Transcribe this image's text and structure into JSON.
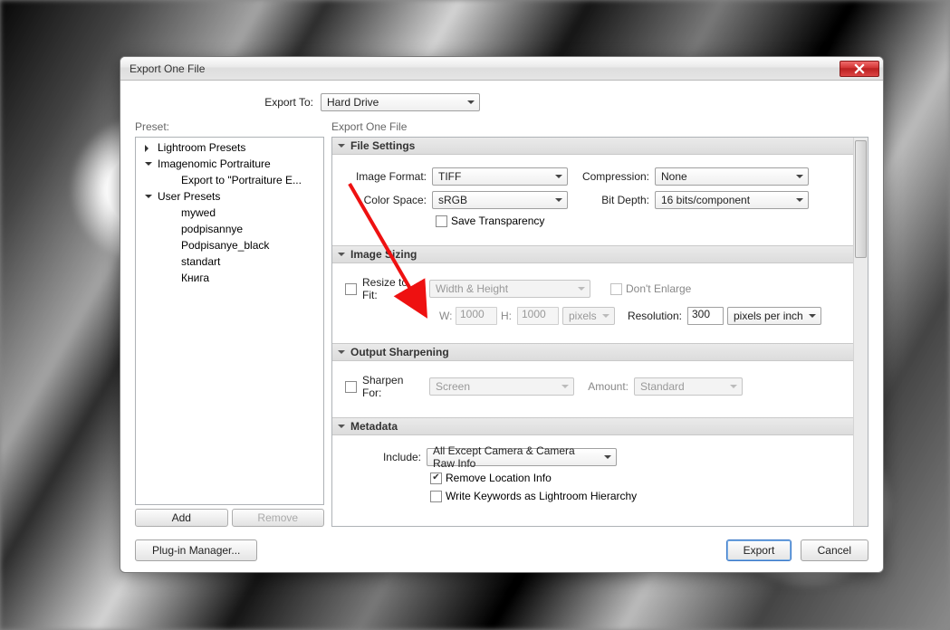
{
  "window": {
    "title": "Export One File"
  },
  "exportTo": {
    "label": "Export To:",
    "value": "Hard Drive"
  },
  "preset": {
    "label": "Preset:",
    "groups": [
      {
        "label": "Lightroom Presets",
        "expanded": false,
        "items": []
      },
      {
        "label": "Imagenomic Portraiture",
        "expanded": true,
        "items": [
          {
            "label": "Export to \"Portraiture E..."
          }
        ]
      },
      {
        "label": "User Presets",
        "expanded": true,
        "items": [
          {
            "label": "mywed"
          },
          {
            "label": "podpisannye"
          },
          {
            "label": "Podpisanye_black"
          },
          {
            "label": "standart"
          },
          {
            "label": "Книга"
          }
        ]
      }
    ],
    "addButton": "Add",
    "removeButton": "Remove"
  },
  "settings": {
    "heading": "Export One File",
    "fileSettings": {
      "title": "File Settings",
      "imageFormat": {
        "label": "Image Format:",
        "value": "TIFF"
      },
      "compression": {
        "label": "Compression:",
        "value": "None"
      },
      "colorSpace": {
        "label": "Color Space:",
        "value": "sRGB"
      },
      "bitDepth": {
        "label": "Bit Depth:",
        "value": "16 bits/component"
      },
      "saveTransparency": {
        "label": "Save Transparency",
        "checked": false
      }
    },
    "imageSizing": {
      "title": "Image Sizing",
      "resizeToFit": {
        "label": "Resize to Fit:",
        "checked": false,
        "mode": "Width & Height"
      },
      "dontEnlarge": {
        "label": "Don't Enlarge",
        "checked": false
      },
      "w": {
        "label": "W:",
        "value": "1000"
      },
      "h": {
        "label": "H:",
        "value": "1000"
      },
      "unit": "pixels",
      "resolution": {
        "label": "Resolution:",
        "value": "300",
        "unit": "pixels per inch"
      }
    },
    "outputSharpening": {
      "title": "Output Sharpening",
      "sharpenFor": {
        "label": "Sharpen For:",
        "checked": false,
        "value": "Screen"
      },
      "amount": {
        "label": "Amount:",
        "value": "Standard"
      }
    },
    "metadata": {
      "title": "Metadata",
      "include": {
        "label": "Include:",
        "value": "All Except Camera & Camera Raw Info"
      },
      "removeLocation": {
        "label": "Remove Location Info",
        "checked": true
      },
      "writeKeywords": {
        "label": "Write Keywords as Lightroom Hierarchy",
        "checked": false
      }
    }
  },
  "footer": {
    "plugin": "Plug-in Manager...",
    "export": "Export",
    "cancel": "Cancel"
  }
}
